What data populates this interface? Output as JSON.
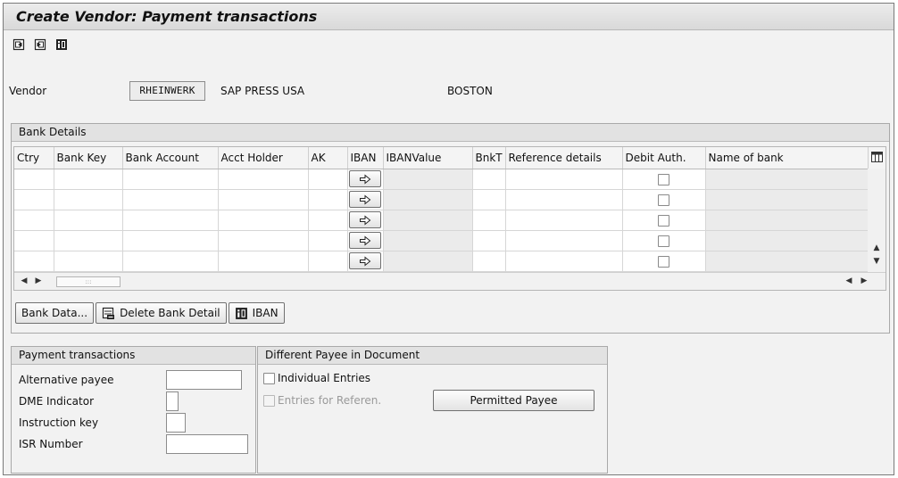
{
  "title": "Create Vendor: Payment transactions",
  "toolbar": {
    "icons": [
      "prev-screen-icon",
      "next-screen-icon",
      "info-icon"
    ]
  },
  "vendor": {
    "label": "Vendor",
    "number": "RHEINWERK",
    "name": "SAP PRESS USA",
    "city": "BOSTON"
  },
  "bank_details": {
    "title": "Bank Details",
    "columns": [
      "Ctry",
      "Bank Key",
      "Bank Account",
      "Acct Holder",
      "AK",
      "IBAN",
      "IBANValue",
      "BnkT",
      "Reference details",
      "Debit Auth.",
      "Name of bank"
    ],
    "row_count": 5,
    "buttons": {
      "bank_data": "Bank Data...",
      "delete_bank_detail": "Delete Bank Detail",
      "iban": "IBAN"
    }
  },
  "payment_transactions": {
    "title": "Payment transactions",
    "fields": {
      "alternative_payee": {
        "label": "Alternative payee",
        "value": ""
      },
      "dme_indicator": {
        "label": "DME Indicator",
        "value": ""
      },
      "instruction_key": {
        "label": "Instruction key",
        "value": ""
      },
      "isr_number": {
        "label": "ISR Number",
        "value": ""
      }
    }
  },
  "different_payee": {
    "title": "Different Payee in Document",
    "individual_entries": {
      "label": "Individual Entries",
      "checked": false
    },
    "entries_for_referen": {
      "label": "Entries for Referen.",
      "checked": false,
      "disabled": true
    },
    "permitted_payee_button": "Permitted Payee"
  }
}
